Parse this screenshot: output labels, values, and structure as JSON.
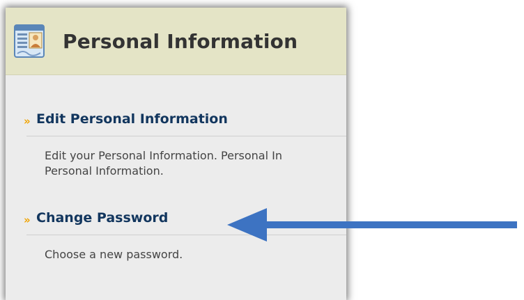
{
  "panel": {
    "title": "Personal Information",
    "icon": "personal-info-card-icon"
  },
  "items": [
    {
      "label": "Edit Personal Information",
      "bullet": "»",
      "description_line1": "Edit your Personal Information. Personal In",
      "description_line2": "Personal Information."
    },
    {
      "label": "Change Password",
      "bullet": "»",
      "description_line1": "Choose a new password."
    }
  ],
  "colors": {
    "header_bg": "#e4e4c6",
    "panel_bg": "#ececec",
    "link": "#12365e",
    "bullet": "#f0a400",
    "arrow": "#3d73c2"
  },
  "annotation": {
    "icon": "arrow-left-icon"
  }
}
